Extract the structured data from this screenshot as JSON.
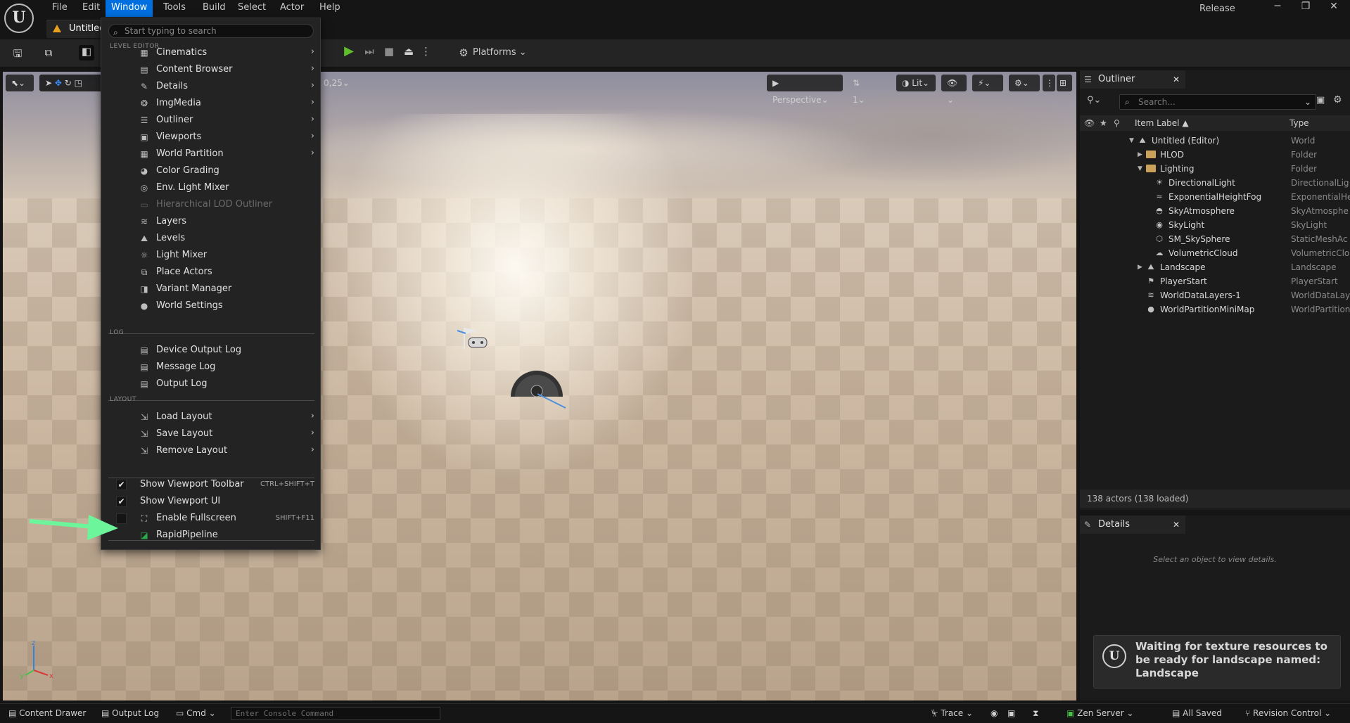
{
  "app": {
    "logo_letter": "U",
    "release_label": "Release",
    "tab_title": "Untitled",
    "menu_bar": [
      "File",
      "Edit",
      "Window",
      "Tools",
      "Build",
      "Select",
      "Actor",
      "Help"
    ],
    "active_menu": "Window",
    "window_controls": [
      "─",
      "❐",
      "✕"
    ]
  },
  "toolbar": {
    "platforms_label": "Platforms"
  },
  "viewport": {
    "snap_value": "0,25",
    "perspective_label": "Perspective",
    "camera_speed": "1",
    "lit_label": "Lit"
  },
  "window_menu": {
    "search_placeholder": "Start typing to search",
    "sections": {
      "level_editor": "LEVEL EDITOR",
      "log": "LOG",
      "layout": "LAYOUT"
    },
    "level_editor_items": [
      {
        "label": "Cinematics",
        "icon": "film-icon",
        "glyph": "▦",
        "submenu": true
      },
      {
        "label": "Content Browser",
        "icon": "folder-grid-icon",
        "glyph": "▤",
        "submenu": true
      },
      {
        "label": "Details",
        "icon": "pencil-icon",
        "glyph": "✎",
        "submenu": true
      },
      {
        "label": "ImgMedia",
        "icon": "media-icon",
        "glyph": "❂",
        "submenu": true
      },
      {
        "label": "Outliner",
        "icon": "list-icon",
        "glyph": "☰",
        "submenu": true
      },
      {
        "label": "Viewports",
        "icon": "viewports-icon",
        "glyph": "▣",
        "submenu": true
      },
      {
        "label": "World Partition",
        "icon": "grid-icon",
        "glyph": "▦",
        "submenu": true
      },
      {
        "label": "Color Grading",
        "icon": "color-wheel-icon",
        "glyph": "◕",
        "submenu": false
      },
      {
        "label": "Env. Light Mixer",
        "icon": "light-mixer-icon",
        "glyph": "◎",
        "submenu": false
      },
      {
        "label": "Hierarchical LOD Outliner",
        "icon": "hlod-icon",
        "glyph": "▭",
        "submenu": false,
        "disabled": true
      },
      {
        "label": "Layers",
        "icon": "layers-icon",
        "glyph": "≋",
        "submenu": false
      },
      {
        "label": "Levels",
        "icon": "levels-icon",
        "glyph": "⛰",
        "submenu": false
      },
      {
        "label": "Light Mixer",
        "icon": "light-mixer-sliders-icon",
        "glyph": "☼",
        "submenu": false
      },
      {
        "label": "Place Actors",
        "icon": "place-actors-icon",
        "glyph": "⧉",
        "submenu": false
      },
      {
        "label": "Variant Manager",
        "icon": "variant-icon",
        "glyph": "◨",
        "submenu": false
      },
      {
        "label": "World Settings",
        "icon": "globe-icon",
        "glyph": "●",
        "submenu": false
      }
    ],
    "log_items": [
      {
        "label": "Device Output Log",
        "icon": "log-icon",
        "glyph": "▤"
      },
      {
        "label": "Message Log",
        "icon": "log-icon",
        "glyph": "▤"
      },
      {
        "label": "Output Log",
        "icon": "log-icon",
        "glyph": "▤"
      }
    ],
    "layout_items": [
      {
        "label": "Load Layout",
        "icon": "load-layout-icon",
        "glyph": "⇲"
      },
      {
        "label": "Save Layout",
        "icon": "save-layout-icon",
        "glyph": "⇲"
      },
      {
        "label": "Remove Layout",
        "icon": "remove-layout-icon",
        "glyph": "⇲"
      }
    ],
    "toggles": [
      {
        "label": "Show Viewport Toolbar",
        "checked": true,
        "shortcut": "CTRL+SHIFT+T"
      },
      {
        "label": "Show Viewport UI",
        "checked": true,
        "shortcut": ""
      },
      {
        "label": "Enable Fullscreen",
        "checked": false,
        "shortcut": "SHIFT+F11",
        "icon": "fullscreen-icon",
        "glyph": "⛶"
      },
      {
        "label": "RapidPipeline",
        "checked": null,
        "shortcut": "",
        "icon": "rapidpipeline-icon",
        "glyph": "◪",
        "accent": "#2aa84a"
      }
    ]
  },
  "annotation": {
    "arrow_color": "#6cf59a"
  },
  "outliner": {
    "tab_label": "Outliner",
    "search_placeholder": "Search...",
    "col_label": "Item Label ▲",
    "col_type": "Type",
    "rows": [
      {
        "label": "Untitled (Editor)",
        "type": "World",
        "indent": 0,
        "expand": "▼",
        "icon": "world-icon",
        "glyph": "⛰"
      },
      {
        "label": "HLOD",
        "type": "Folder",
        "indent": 1,
        "expand": "▶",
        "icon": "folder-icon"
      },
      {
        "label": "Lighting",
        "type": "Folder",
        "indent": 1,
        "expand": "▼",
        "icon": "folder-icon"
      },
      {
        "label": "DirectionalLight",
        "type": "DirectionalLig",
        "indent": 2,
        "icon": "sun-icon",
        "glyph": "☀"
      },
      {
        "label": "ExponentialHeightFog",
        "type": "ExponentialHe",
        "indent": 2,
        "icon": "fog-icon",
        "glyph": "≈"
      },
      {
        "label": "SkyAtmosphere",
        "type": "SkyAtmosphe",
        "indent": 2,
        "icon": "atmosphere-icon",
        "glyph": "◓"
      },
      {
        "label": "SkyLight",
        "type": "SkyLight",
        "indent": 2,
        "icon": "skylight-icon",
        "glyph": "◉"
      },
      {
        "label": "SM_SkySphere",
        "type": "StaticMeshAc",
        "indent": 2,
        "icon": "cube-icon",
        "glyph": "⬡"
      },
      {
        "label": "VolumetricCloud",
        "type": "VolumetricClo",
        "indent": 2,
        "icon": "cloud-icon",
        "glyph": "☁"
      },
      {
        "label": "Landscape",
        "type": "Landscape",
        "indent": 1,
        "expand": "▶",
        "icon": "landscape-icon",
        "glyph": "⛰"
      },
      {
        "label": "PlayerStart",
        "type": "PlayerStart",
        "indent": 1,
        "icon": "flag-icon",
        "glyph": "⚑"
      },
      {
        "label": "WorldDataLayers-1",
        "type": "WorldDataLay",
        "indent": 1,
        "icon": "layers-icon",
        "glyph": "≋"
      },
      {
        "label": "WorldPartitionMiniMap",
        "type": "WorldPartition",
        "indent": 1,
        "icon": "globe-icon",
        "glyph": "●"
      }
    ],
    "footer": "138 actors (138 loaded)"
  },
  "details": {
    "tab_label": "Details",
    "empty_text": "Select an object to view details."
  },
  "toast": {
    "logo_letter": "U",
    "text": "Waiting for texture resources to be ready for landscape named: Landscape"
  },
  "statusbar": {
    "content_drawer": "Content Drawer",
    "output_log": "Output Log",
    "cmd": "Cmd",
    "console_placeholder": "Enter Console Command",
    "trace": "Trace",
    "zen_server": "Zen Server",
    "all_saved": "All Saved",
    "revision_control": "Revision Control"
  }
}
